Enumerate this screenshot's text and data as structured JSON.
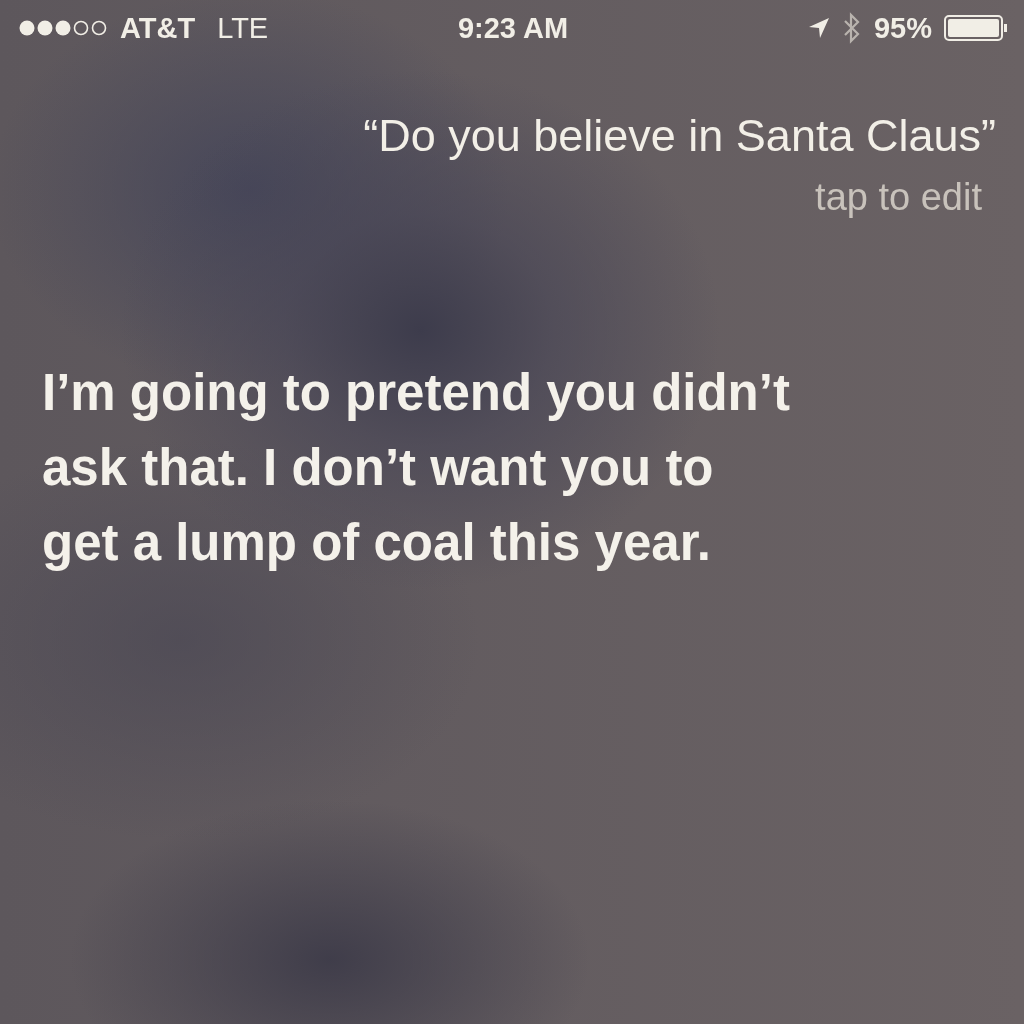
{
  "status_bar": {
    "carrier": "AT&T",
    "network": "LTE",
    "time": "9:23 AM",
    "battery_percent": "95%"
  },
  "query": {
    "text": "“Do you believe in Santa Claus”",
    "edit_hint": "tap to edit"
  },
  "answer": {
    "text": "I’m going to pretend you didn’t ask that. I don’t want you to get a lump of coal this year."
  }
}
